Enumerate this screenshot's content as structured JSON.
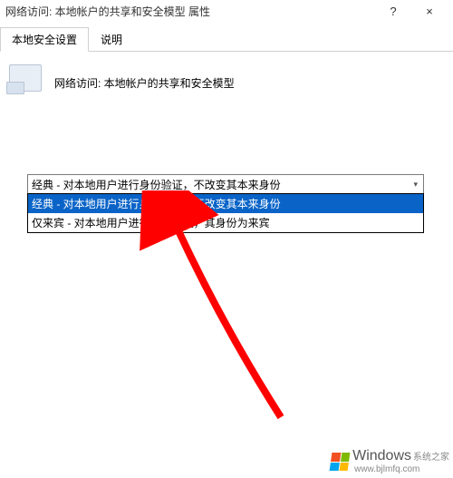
{
  "title": "网络访问: 本地帐户的共享和安全模型 属性",
  "window_buttons": {
    "help": "?",
    "close": "×"
  },
  "tabs": {
    "active": "本地安全设置",
    "other": "说明"
  },
  "policy": {
    "label": "网络访问: 本地帐户的共享和安全模型"
  },
  "dropdown": {
    "selected": "经典 - 对本地用户进行身份验证，不改变其本来身份",
    "options": [
      "经典 - 对本地用户进行身份验证，不改变其本来身份",
      "仅来宾 - 对本地用户进行身份验证，其身份为来宾"
    ],
    "highlighted_index": 0
  },
  "watermark": {
    "brand": "Windows",
    "suffix": "系统之家",
    "url": "www.bjlmfq.com"
  }
}
